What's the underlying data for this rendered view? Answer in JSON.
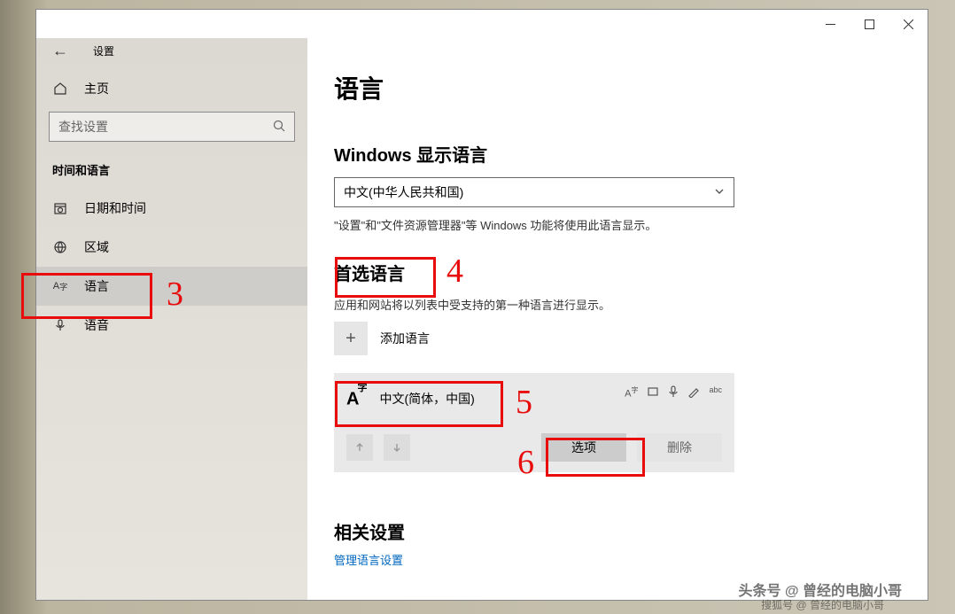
{
  "window": {
    "app_label": "设置"
  },
  "sidebar": {
    "home": "主页",
    "search_placeholder": "查找设置",
    "category": "时间和语言",
    "items": [
      {
        "label": "日期和时间"
      },
      {
        "label": "区域"
      },
      {
        "label": "语言"
      },
      {
        "label": "语音"
      }
    ]
  },
  "content": {
    "title": "语言",
    "display_section": "Windows 显示语言",
    "display_value": "中文(中华人民共和国)",
    "display_helper": "\"设置\"和\"文件资源管理器\"等 Windows 功能将使用此语言显示。",
    "preferred_section": "首选语言",
    "preferred_helper": "应用和网站将以列表中受支持的第一种语言进行显示。",
    "add_label": "添加语言",
    "lang_item": "中文(简体，中国)",
    "options_btn": "选项",
    "delete_btn": "删除",
    "related_title": "相关设置",
    "related_link": "管理语言设置"
  },
  "annotations": {
    "n3": "3",
    "n4": "4",
    "n5": "5",
    "n6": "6"
  },
  "watermark": {
    "line1": "头条号 @ 曾经的电脑小哥",
    "line2": "搜狐号 @ 曾经的电脑小哥"
  }
}
